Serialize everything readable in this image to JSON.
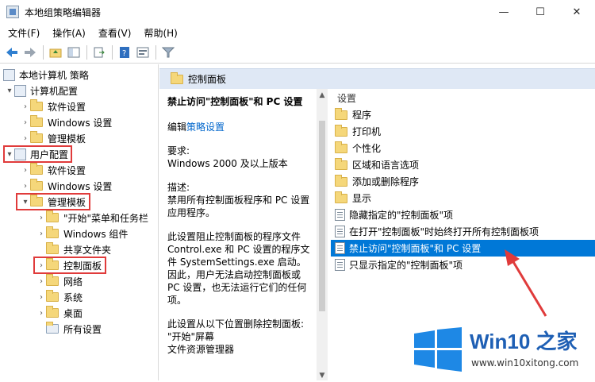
{
  "window": {
    "title": "本地组策略编辑器",
    "min": "—",
    "max": "☐",
    "close": "✕"
  },
  "menu": [
    "文件(F)",
    "操作(A)",
    "查看(V)",
    "帮助(H)"
  ],
  "tree": {
    "root": "本地计算机 策略",
    "computer_config": "计算机配置",
    "cc_children": [
      "软件设置",
      "Windows 设置",
      "管理模板"
    ],
    "user_config": "用户配置",
    "uc_children": [
      "软件设置",
      "Windows 设置"
    ],
    "admin_templates": "管理模板",
    "at_children": [
      "\"开始\"菜单和任务栏",
      "Windows 组件",
      "共享文件夹",
      "控制面板",
      "网络",
      "系统",
      "桌面",
      "所有设置"
    ]
  },
  "header": {
    "title": "控制面板"
  },
  "description": {
    "title": "禁止访问\"控制面板\"和 PC 设置",
    "edit_prefix": "编辑",
    "edit_link": "策略设置",
    "requirements_label": "要求:",
    "requirements": "Windows 2000 及以上版本",
    "desc_label": "描述:",
    "desc": "禁用所有控制面板程序和 PC 设置应用程序。",
    "para1": "此设置阻止控制面板的程序文件 Control.exe 和 PC 设置的程序文件 SystemSettings.exe 启动。因此，用户无法启动控制面板或 PC 设置，也无法运行它们的任何项。",
    "para2": "此设置从以下位置删除控制面板:",
    "para2a": "\"开始\"屏幕",
    "para2b": "文件资源管理器"
  },
  "list": {
    "header": "设置",
    "folders": [
      "程序",
      "打印机",
      "个性化",
      "区域和语言选项",
      "添加或删除程序",
      "显示"
    ],
    "policies": [
      "隐藏指定的\"控制面板\"项",
      "在打开\"控制面板\"时始终打开所有控制面板项",
      "禁止访问\"控制面板\"和 PC 设置",
      "只显示指定的\"控制面板\"项"
    ],
    "selected_index": 2
  },
  "watermark": {
    "title": "Win10 之家",
    "url": "www.win10xitong.com"
  },
  "colors": {
    "selection": "#0078d7",
    "annotation": "#e03b3b",
    "header_bg": "#dfe8f5"
  }
}
